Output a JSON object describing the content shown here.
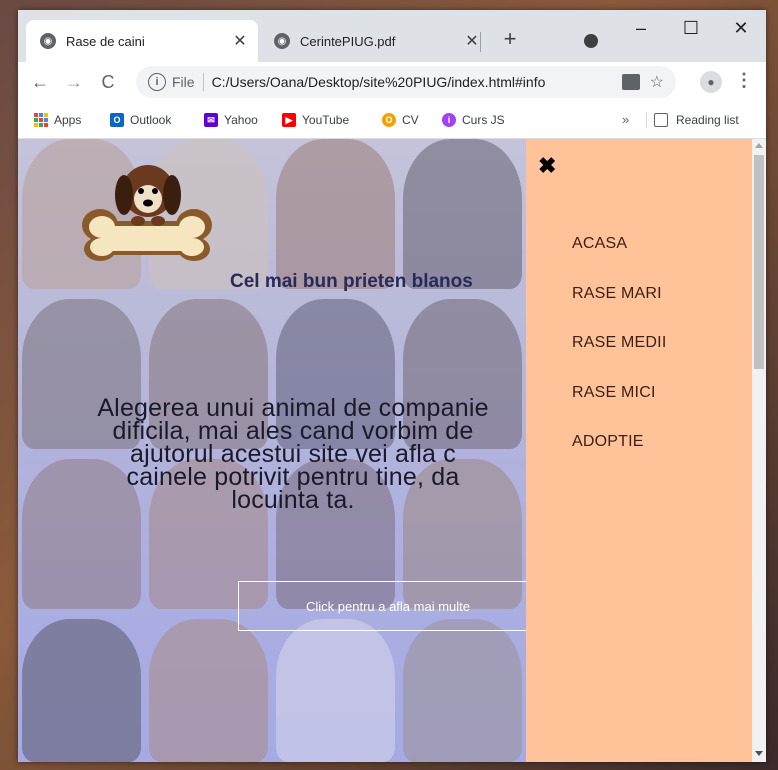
{
  "browser": {
    "tabs": [
      {
        "title": "Rase de caini",
        "active": true
      },
      {
        "title": "CerintePIUG.pdf",
        "active": false
      }
    ],
    "new_tab": "+",
    "window_controls": {
      "minimize": "–",
      "maximize": "☐",
      "close": "✕"
    },
    "tab_close": "✕",
    "nav": {
      "back": "←",
      "forward": "→",
      "reload": "C"
    },
    "omnibox": {
      "info": "i",
      "file_label": "File",
      "url": "C:/Users/Oana/Desktop/site%20PIUG/index.html#info",
      "star": "☆"
    },
    "menu": "⋮",
    "avatar": "●",
    "bookmarks": [
      {
        "label": "Apps"
      },
      {
        "label": "Outlook",
        "icon_text": "O",
        "color": "#0a66c2"
      },
      {
        "label": "Yahoo",
        "icon_text": "✉",
        "color": "#6001d2"
      },
      {
        "label": "YouTube",
        "icon_text": "▶",
        "color": "#ff0000"
      },
      {
        "label": "CV",
        "icon_text": "O",
        "color": "#f4a300"
      },
      {
        "label": "Curs JS",
        "icon_text": "i",
        "color": "#a142f4"
      }
    ],
    "bookmarks_more": "»",
    "reading_list": "Reading list"
  },
  "page": {
    "tagline": "Cel mai bun prieten blanos",
    "intro": "Alegerea unui animal de companie\ndificila, mai ales cand vorbim de\najutorul acestui site vei afla c\ncainele potrivit pentru tine, da\nlocuinta ta.",
    "cta": "Click pentru a afla mai multe"
  },
  "sidenav": {
    "close": "✖",
    "links": [
      "ACASA",
      "RASE MARI",
      "RASE MEDII",
      "RASE MICI",
      "ADOPTIE"
    ],
    "bg_color": "#ffc299"
  }
}
